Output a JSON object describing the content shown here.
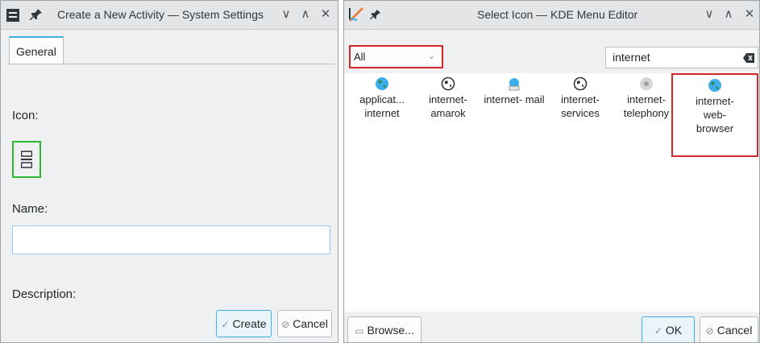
{
  "left_window": {
    "title": "Create a New Activity — System Settings",
    "tab_label": "General",
    "icon_label": "Icon:",
    "name_label": "Name:",
    "name_value": "",
    "description_label": "Description:",
    "create_label": "Create",
    "cancel_label": "Cancel",
    "icon_button_icon": "activities-icon"
  },
  "right_window": {
    "title": "Select Icon — KDE Menu Editor",
    "filter_value": "All",
    "search_value": "internet",
    "icons": [
      {
        "label": "applicat... internet",
        "icon": "globe-color-icon",
        "selected": false
      },
      {
        "label": "internet- amarok",
        "icon": "globe-outline-icon",
        "selected": false
      },
      {
        "label": "internet- mail",
        "icon": "mail-globe-icon",
        "selected": false
      },
      {
        "label": "internet- services",
        "icon": "globe-outline-icon",
        "selected": false
      },
      {
        "label": "internet- telephony",
        "icon": "telephony-icon",
        "selected": false
      },
      {
        "label": "internet- web- browser",
        "icon": "globe-color-icon",
        "selected": true
      }
    ],
    "browse_label": "Browse...",
    "ok_label": "OK",
    "cancel_label": "Cancel"
  },
  "colors": {
    "highlight_red": "#d62728",
    "highlight_green": "#2eb82e",
    "accent": "#3daee9"
  }
}
